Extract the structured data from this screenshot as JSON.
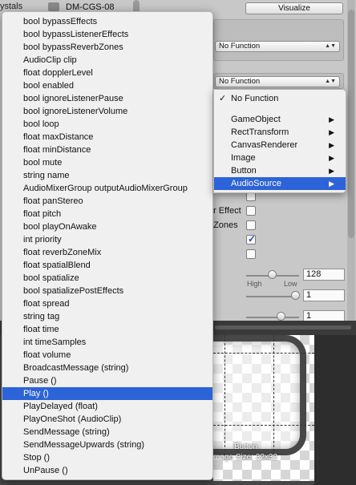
{
  "inspector": {
    "hierarchy_partial": "ystals",
    "hierarchy_item": "DM-CGS-08",
    "visualize_label": "Visualize",
    "dropdown1_value": "No Function",
    "dropdown2_value": "No Function",
    "prop_effect": "r Effect",
    "prop_zones": "Zones",
    "priority_value": "128",
    "priority_high": "High",
    "priority_low": "Low",
    "field2_value": "1",
    "field3_value": "1"
  },
  "preview": {
    "name": "Button",
    "size": "mage Size: 32x32"
  },
  "main_menu": {
    "items": [
      "bool bypassEffects",
      "bool bypassListenerEffects",
      "bool bypassReverbZones",
      "AudioClip clip",
      "float dopplerLevel",
      "bool enabled",
      "bool ignoreListenerPause",
      "bool ignoreListenerVolume",
      "bool loop",
      "float maxDistance",
      "float minDistance",
      "bool mute",
      "string name",
      "AudioMixerGroup outputAudioMixerGroup",
      "float panStereo",
      "float pitch",
      "bool playOnAwake",
      "int priority",
      "float reverbZoneMix",
      "float spatialBlend",
      "bool spatialize",
      "bool spatializePostEffects",
      "float spread",
      "string tag",
      "float time",
      "int timeSamples",
      "float volume",
      "BroadcastMessage (string)",
      "Pause ()",
      "Play ()",
      "PlayDelayed (float)",
      "PlayOneShot (AudioClip)",
      "SendMessage (string)",
      "SendMessageUpwards (string)",
      "Stop ()",
      "UnPause ()"
    ],
    "selected_index": 29
  },
  "sub_menu": {
    "check_glyph": "✓",
    "arrow_glyph": "▶",
    "no_function": "No Function",
    "items": [
      "GameObject",
      "RectTransform",
      "CanvasRenderer",
      "Image",
      "Button",
      "AudioSource"
    ],
    "selected": "AudioSource"
  },
  "colors": {
    "selection": "#2d63d8",
    "menu_bg": "#f0f0f0",
    "inspector_bg": "#c8c8c8",
    "preview_bg": "#474747"
  }
}
